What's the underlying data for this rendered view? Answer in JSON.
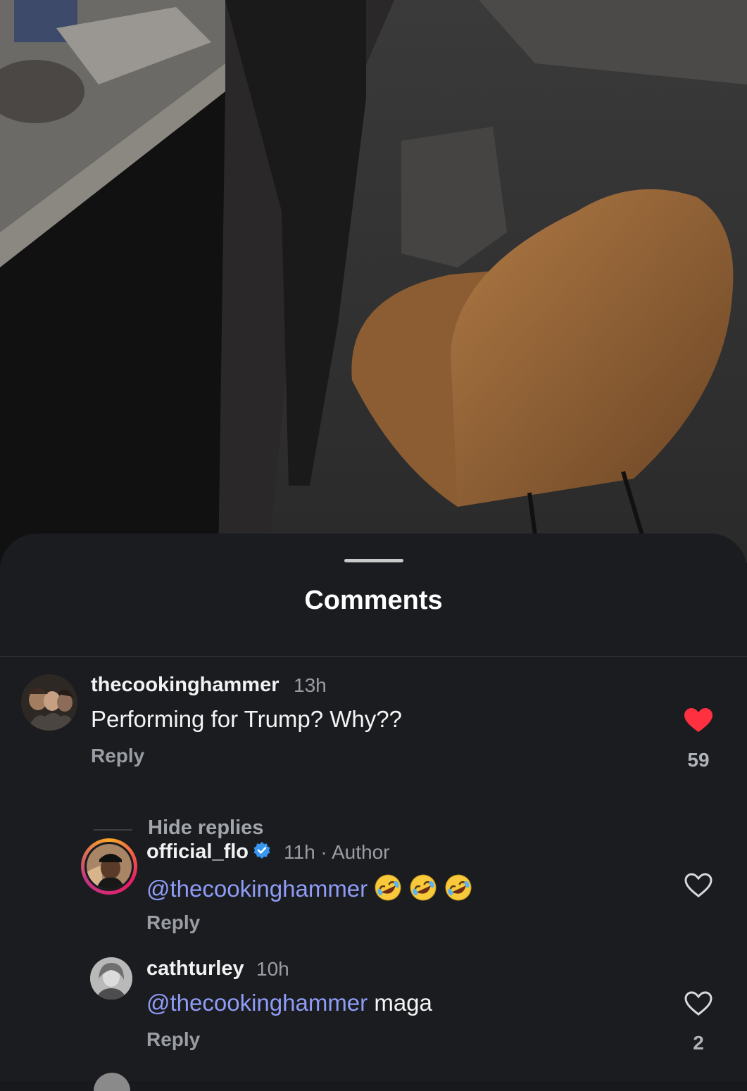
{
  "sheet": {
    "title": "Comments"
  },
  "comments": [
    {
      "username": "thecookinghammer",
      "time": "13h",
      "text": "Performing for Trump? Why??",
      "reply_label": "Reply",
      "likes": "59",
      "liked": true,
      "hide_replies_label": "Hide replies"
    }
  ],
  "replies": [
    {
      "username": "official_flo",
      "verified": true,
      "time": "11h",
      "separator": "·",
      "badge": "Author",
      "mention": "@thecookinghammer",
      "emoji": [
        "rolling-on-floor-laughing",
        "rolling-on-floor-laughing",
        "rolling-on-floor-laughing"
      ],
      "reply_label": "Reply",
      "liked": false
    },
    {
      "username": "cathturley",
      "time": "10h",
      "mention": "@thecookinghammer",
      "text": " maga",
      "reply_label": "Reply",
      "likes": "2",
      "liked": false
    }
  ],
  "colors": {
    "sheet_bg": "#1a1c20",
    "mention": "#8f9cf5",
    "like_red": "#ff3040",
    "verified_blue": "#3897f0"
  }
}
